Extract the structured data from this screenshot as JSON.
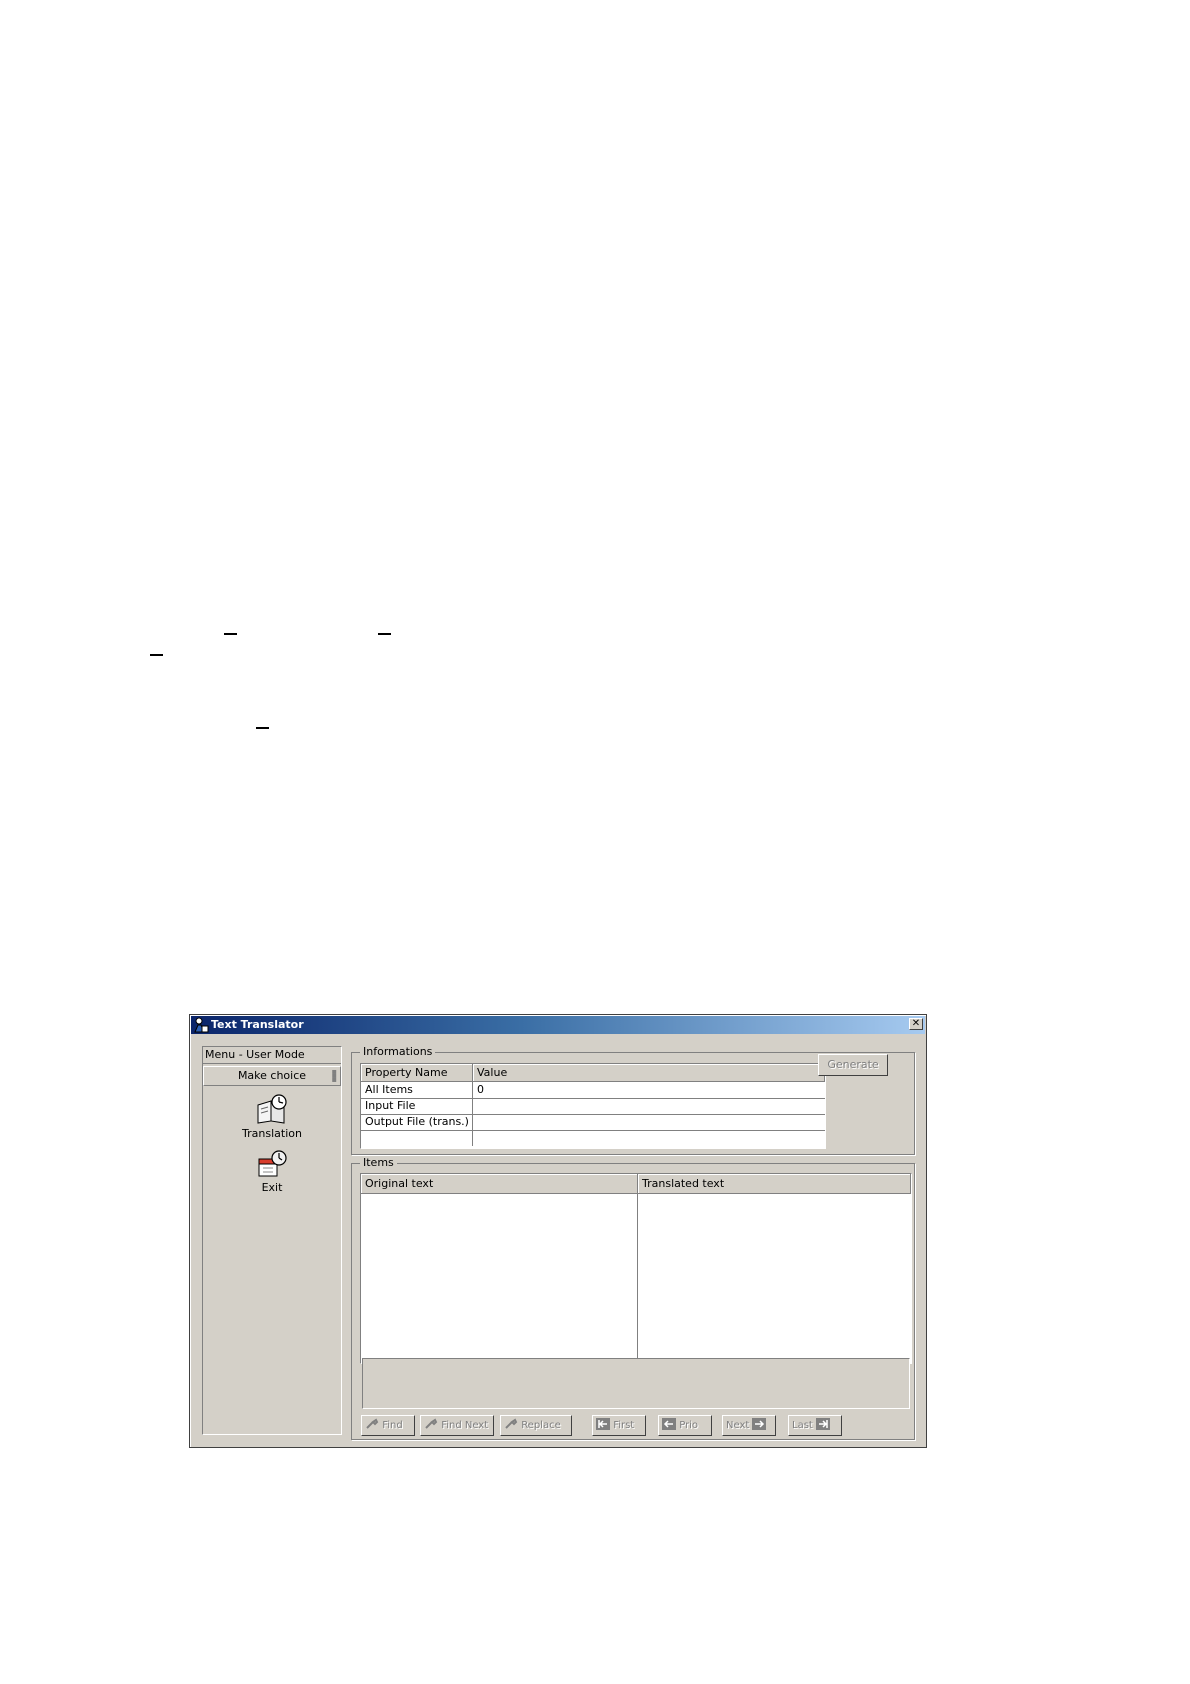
{
  "window": {
    "title": "Text Translator",
    "close_label": "✕"
  },
  "sidebar": {
    "menu_header": "Menu - User Mode",
    "make_choice": "Make choice",
    "items": [
      {
        "label": "Translation",
        "icon": "book-clock-icon"
      },
      {
        "label": "Exit",
        "icon": "calendar-clock-exit-icon"
      }
    ]
  },
  "informations": {
    "legend": "Informations",
    "columns": [
      "Property Name",
      "Value"
    ],
    "rows": [
      {
        "name": "All Items",
        "value": "0"
      },
      {
        "name": "Input File",
        "value": ""
      },
      {
        "name": "Output File (trans.)",
        "value": ""
      },
      {
        "name": "",
        "value": ""
      }
    ],
    "generate_label": "Generate"
  },
  "items": {
    "legend": "Items",
    "columns": [
      "Original text",
      "Translated text"
    ]
  },
  "toolbar": {
    "find": "Find",
    "find_next": "Find Next",
    "replace": "Replace",
    "first": "First",
    "prior": "Prio",
    "next": "Next",
    "last": "Last"
  },
  "colors": {
    "face": "#d4d0c8",
    "titlebar_start": "#0a246a",
    "titlebar_end": "#a6caf0"
  }
}
